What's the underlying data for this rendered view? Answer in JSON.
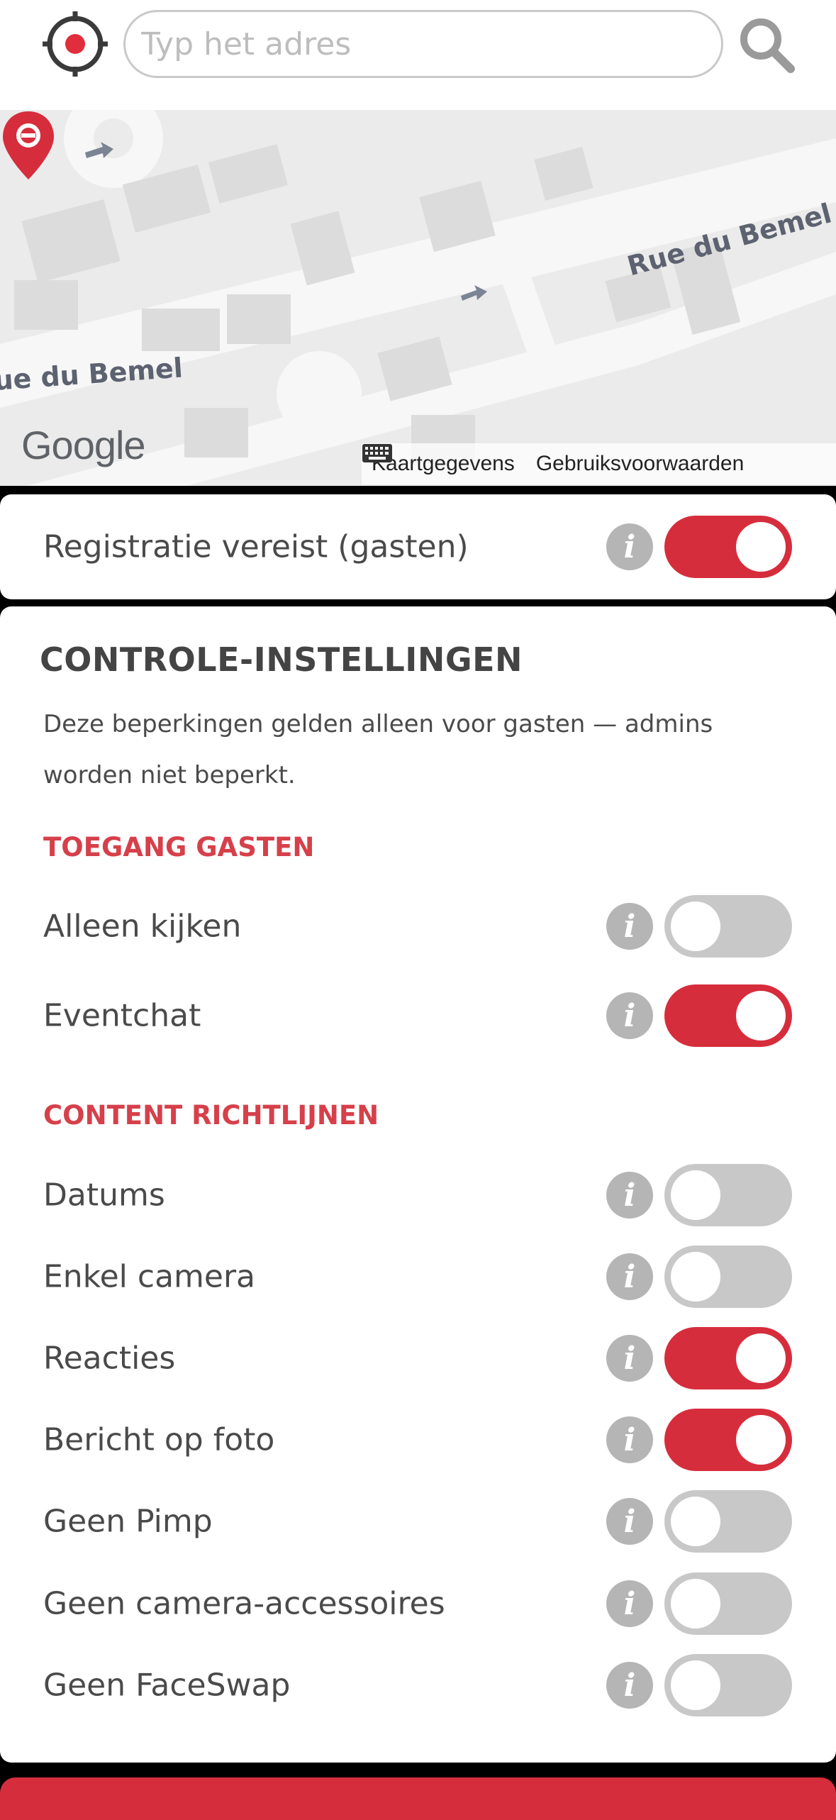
{
  "search": {
    "placeholder": "Typ het adres"
  },
  "map": {
    "street_top": "Rue du Bemel",
    "street_left": "ue du Bemel",
    "provider": "Google",
    "map_data_link": "Kaartgegevens",
    "terms_link": "Gebruiksvoorwaarden"
  },
  "registration": {
    "label": "Registratie vereist (gasten)",
    "enabled": true
  },
  "controls": {
    "title": "CONTROLE-INSTELLINGEN",
    "description": "Deze beperkingen gelden alleen voor gasten — admins worden niet beperkt.",
    "guest_access": {
      "heading": "TOEGANG GASTEN",
      "items": [
        {
          "label": "Alleen kijken",
          "enabled": false
        },
        {
          "label": "Eventchat",
          "enabled": true
        }
      ]
    },
    "content_guidelines": {
      "heading": "CONTENT RICHTLIJNEN",
      "items": [
        {
          "label": "Datums",
          "enabled": false
        },
        {
          "label": "Enkel camera",
          "enabled": false
        },
        {
          "label": "Reacties",
          "enabled": true
        },
        {
          "label": "Bericht op foto",
          "enabled": true
        },
        {
          "label": "Geen Pimp",
          "enabled": false
        },
        {
          "label": "Geen camera-accessoires",
          "enabled": false
        },
        {
          "label": "Geen FaceSwap",
          "enabled": false
        }
      ]
    }
  },
  "colors": {
    "accent": "#d62d3c",
    "toggle_off": "#c8c8c8",
    "info_icon": "#b5b5b5"
  },
  "icons": {
    "locate": "crosshair-target-icon",
    "search": "magnifier-icon",
    "info": "info-icon",
    "pin": "map-pin-icon",
    "keyboard": "keyboard-icon"
  }
}
